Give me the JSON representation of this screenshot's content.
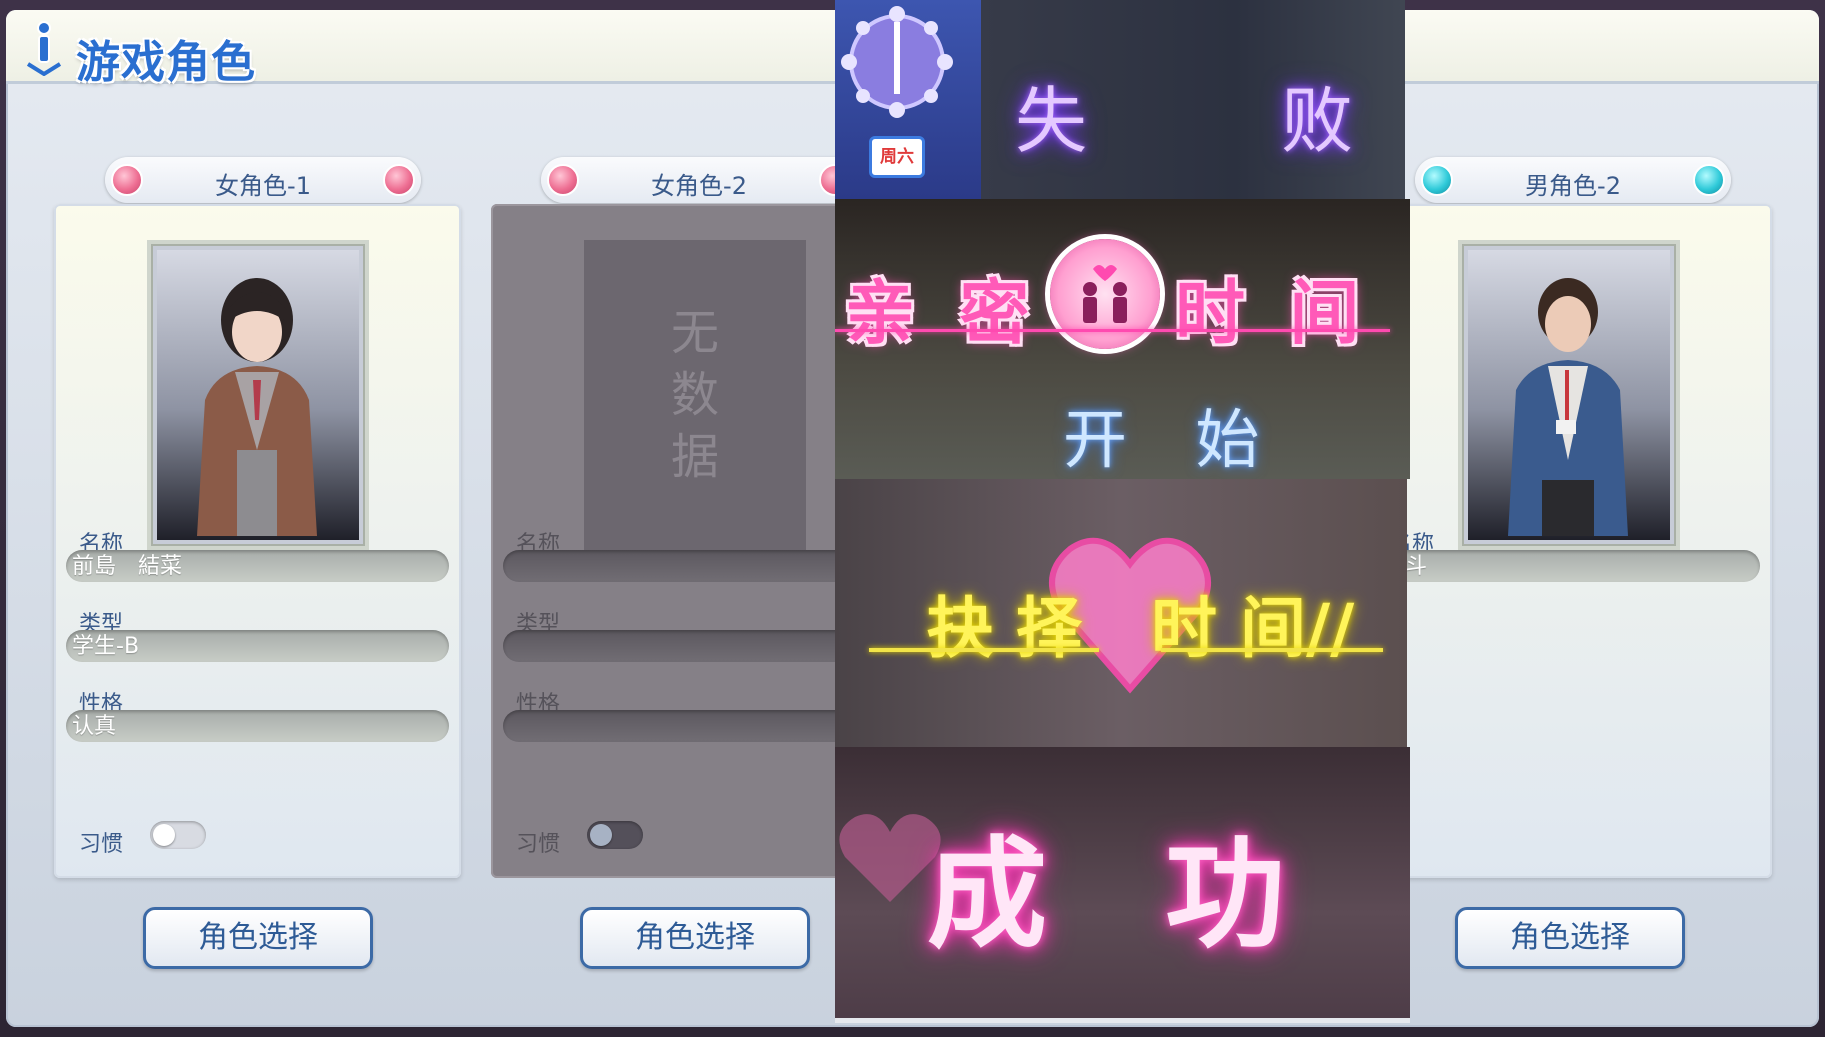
{
  "window": {
    "title": "游戏角色"
  },
  "columns": [
    {
      "header": "女角色-1",
      "dot_color": "pink",
      "portrait": "girl-student-portrait",
      "name_label": "名称",
      "name_value": "前島　結菜",
      "type_label": "类型",
      "type_value": "学生-B",
      "personality_label": "性格",
      "personality_value": "认真",
      "habit_label": "习惯",
      "habit_on": false,
      "select_label": "角色选择"
    },
    {
      "header": "女角色-2",
      "dot_color": "pink",
      "nodata_text": "无\n数\n据",
      "name_label": "名称",
      "name_value": "",
      "type_label": "类型",
      "type_value": "",
      "personality_label": "性格",
      "personality_value": "",
      "habit_label": "习惯",
      "habit_on": false,
      "select_label": "角色选择"
    },
    {
      "header": "男角色-2",
      "dot_color": "teal",
      "portrait": "boy-student-portrait",
      "name_label": "名称",
      "name_value": "琉斗",
      "select_label": "角色选择"
    }
  ],
  "overlay": {
    "weekday": "周六",
    "fail": [
      "失",
      "败"
    ],
    "intimate": [
      "亲 密",
      "时 间"
    ],
    "start": "开 始",
    "choose": [
      "抉 择",
      "时 间//"
    ],
    "success": [
      "成",
      "功"
    ]
  },
  "colors": {
    "accent": "#2a6fd0",
    "pink_dot": "#ee6f93",
    "teal_dot": "#2fcad9",
    "neon_pink": "#ff4ab0",
    "neon_yellow": "#fff45a",
    "neon_purple": "#a566ff"
  }
}
